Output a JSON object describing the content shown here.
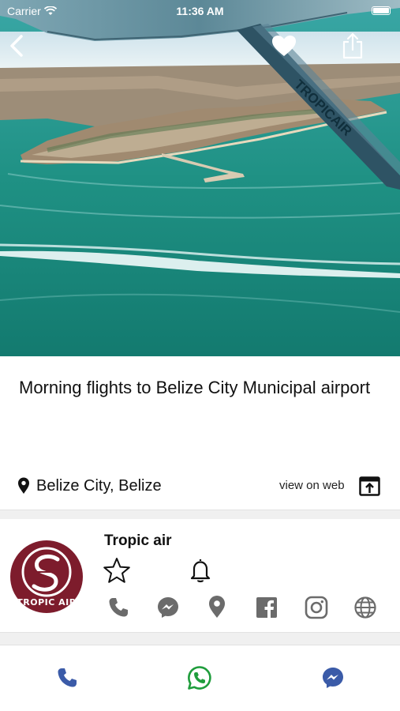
{
  "status_bar": {
    "carrier": "Carrier",
    "time": "11:36 AM"
  },
  "hero": {
    "plane_marking": "TROPICAIR"
  },
  "listing": {
    "title": "Morning flights to Belize City Municipal airport",
    "location": "Belize City, Belize",
    "web_link": "view on web"
  },
  "business": {
    "name": "Tropic air",
    "logo_text": "TROPIC AIR",
    "logo_color": "#7d1c2c",
    "actions": [
      "phone-icon",
      "messenger-icon",
      "map-pin-icon",
      "facebook-icon",
      "instagram-icon",
      "globe-icon"
    ]
  },
  "bottom_bar": {
    "buttons": [
      "phone-icon",
      "whatsapp-icon",
      "messenger-icon"
    ],
    "colors": {
      "phone": "#3b5ba8",
      "whatsapp": "#1f9d3c",
      "messenger": "#3b5ba8"
    }
  },
  "colors": {
    "icon_gray": "#6b6b6b",
    "water": "#1f8f86"
  }
}
